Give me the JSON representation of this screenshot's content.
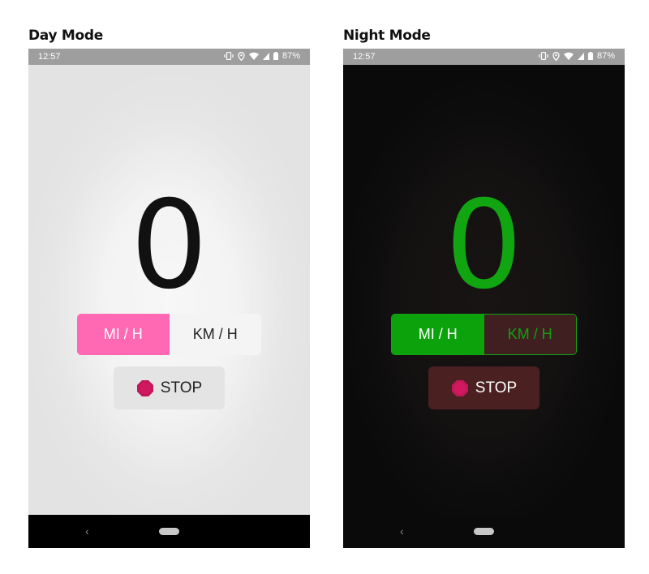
{
  "captions": {
    "day": "Day Mode",
    "night": "Night Mode"
  },
  "status_bar": {
    "time": "12:57",
    "battery": "87%"
  },
  "speedometer": {
    "speed": "0"
  },
  "units": {
    "mi_label": "MI / H",
    "km_label": "KM / H"
  },
  "stop_button": {
    "label": "STOP"
  },
  "navbar": {
    "back_glyph": "‹"
  },
  "colors": {
    "day_selected": "#ff69b4",
    "night_accent": "#11a611",
    "night_stop_bg": "#4a2020",
    "stop_icon": "#c2185b"
  },
  "icons": [
    "vibrate-icon",
    "location-icon",
    "wifi-icon",
    "signal-icon",
    "battery-icon",
    "stop-octagon-icon",
    "back-icon",
    "home-pill-icon"
  ]
}
